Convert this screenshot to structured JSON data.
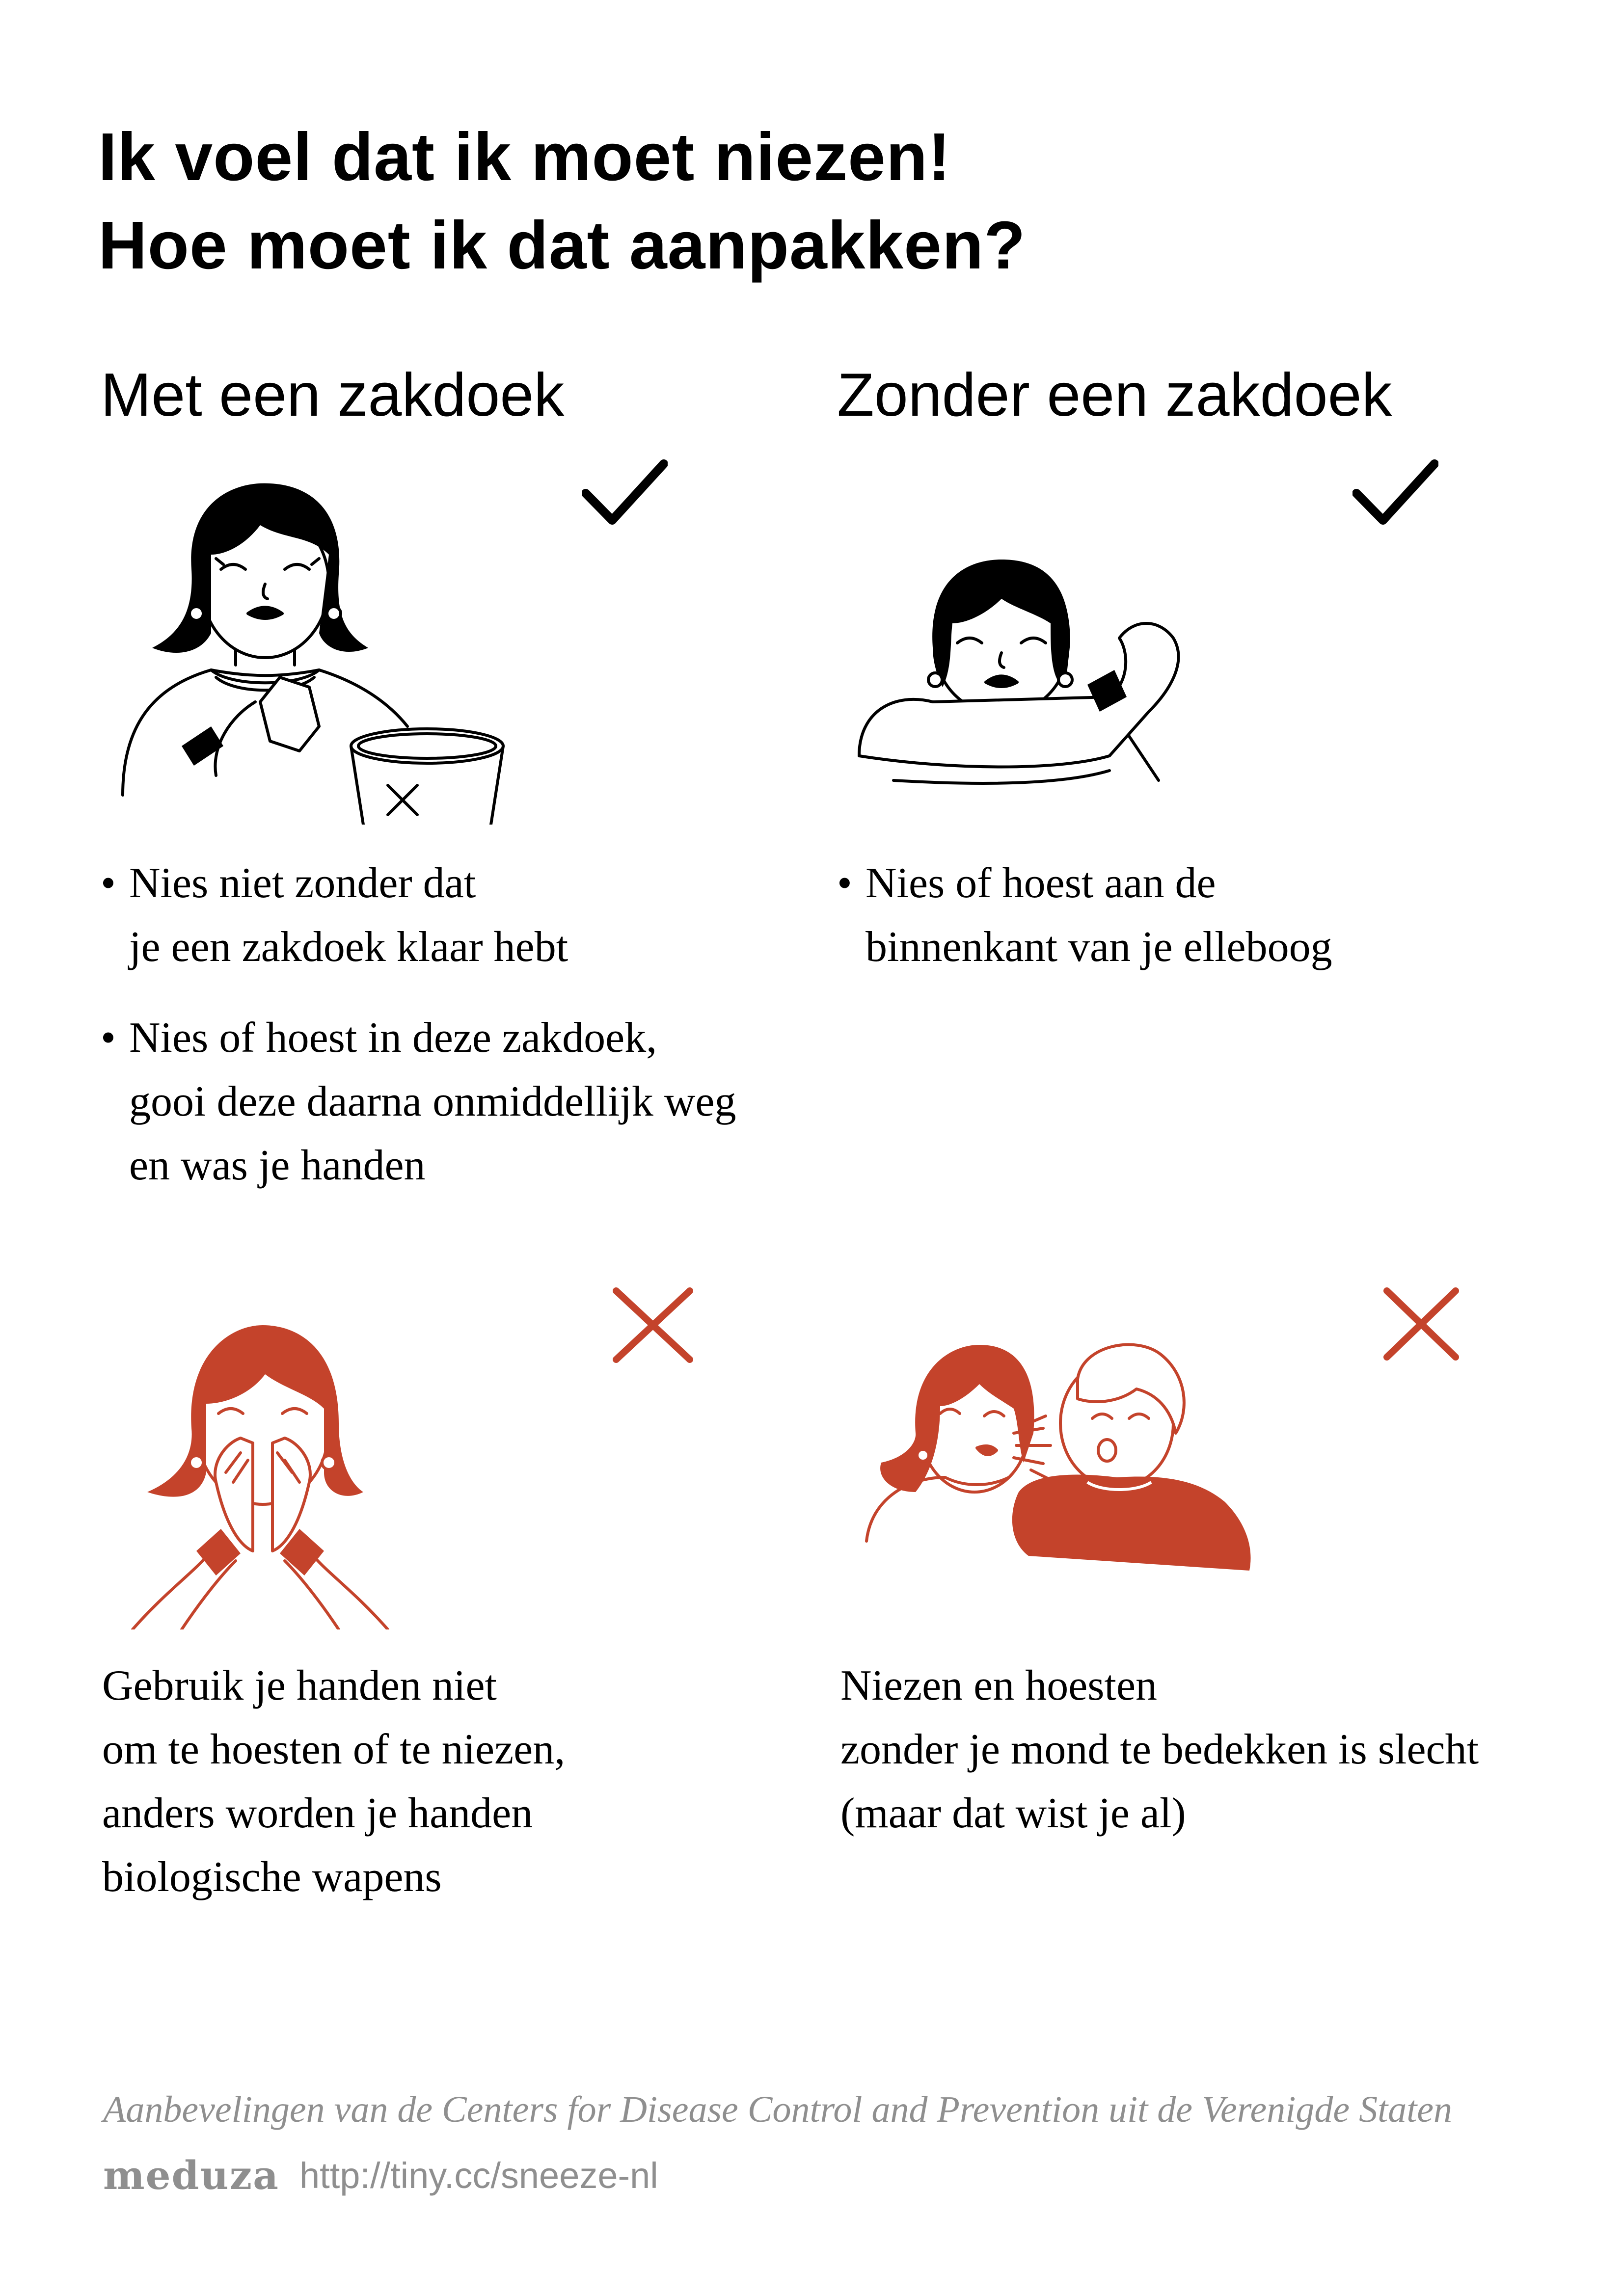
{
  "title": {
    "line1": "Ik voel dat ik moet niezen!",
    "line2": "Hoe moet ik dat aanpakken?"
  },
  "colors": {
    "text": "#000000",
    "accent": "#c4432b",
    "muted": "#8f8f8f",
    "background": "#ffffff"
  },
  "sections": {
    "with_tissue": {
      "heading": "Met een zakdoek",
      "status_icon": "check-icon",
      "illustration": "woman-sneezing-into-tissue-with-bin-icon",
      "bullets": [
        {
          "dot": "•",
          "lines": [
            "Nies niet zonder dat",
            "je een zakdoek klaar hebt"
          ]
        },
        {
          "dot": "•",
          "lines": [
            "Nies of hoest in deze zakdoek,",
            "gooi deze daarna onmiddellijk weg",
            "en was je handen"
          ]
        }
      ]
    },
    "without_tissue": {
      "heading": "Zonder een zakdoek",
      "status_icon": "check-icon",
      "illustration": "woman-sneezing-into-elbow-icon",
      "bullets": [
        {
          "dot": "•",
          "lines": [
            "Nies of hoest aan de",
            "binnenkant van je elleboog"
          ]
        }
      ]
    },
    "hands": {
      "status_icon": "cross-icon",
      "illustration": "woman-sneezing-into-hands-icon",
      "lines": [
        "Gebruik je handen niet",
        "om te hoesten of te niezen,",
        "anders worden je handen",
        "biologische wapens"
      ]
    },
    "uncovered": {
      "status_icon": "cross-icon",
      "illustration": "woman-sneezing-at-man-icon",
      "lines": [
        "Niezen en hoesten",
        "zonder je mond te bedekken is slecht",
        "(maar dat wist je al)"
      ]
    }
  },
  "footer": {
    "credit": "Aanbevelingen van de Centers for Disease Control and Prevention uit de Verenigde Staten",
    "logo": "meduza",
    "url": "http://tiny.cc/sneeze-nl"
  }
}
